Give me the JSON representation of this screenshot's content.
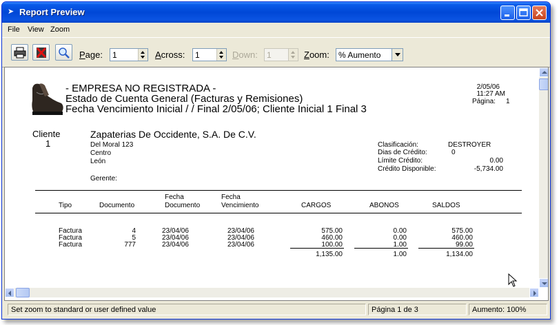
{
  "window": {
    "title": "Report Preview"
  },
  "menu": {
    "items": [
      "File",
      "View",
      "Zoom"
    ]
  },
  "toolbar": {
    "page": {
      "label_u": "P",
      "label_rest": "age:",
      "value": "1"
    },
    "across": {
      "label_u": "A",
      "label_rest": "cross:",
      "value": "1"
    },
    "down": {
      "label_u": "D",
      "label_rest": "own:",
      "value": "1"
    },
    "zoom": {
      "label_u": "Z",
      "label_rest": "oom:",
      "value": "% Aumento"
    }
  },
  "report": {
    "company": "- EMPRESA NO REGISTRADA -",
    "title": "Estado de Cuenta General (Facturas y Remisiones)",
    "subtitle": "Fecha Vencimiento Inicial   /  / Final  2/05/06;   Cliente Inicial 1 Final 3",
    "date": "2/05/06",
    "time": "11:27 AM",
    "page_label": "Página:",
    "page_num": "1",
    "client_label": "Cliente",
    "client_num": "1",
    "client_name": "Zapaterias De Occidente, S.A. De C.V.",
    "address1": "Del Moral 123",
    "address2": "Centro",
    "city": "León",
    "manager_label": "Gerente:",
    "info": {
      "clasificacion_label": "Clasificación:",
      "clasificacion": "DESTROYER",
      "dias_label": "Dias de Crédito:",
      "dias": "0",
      "limite_label": "Límite Crédito:",
      "limite": "0.00",
      "disponible_label": "Crédito Disponible:",
      "disponible": "-5,734.00"
    },
    "columns": {
      "tipo": "Tipo",
      "documento": "Documento",
      "fecha_doc_1": "Fecha",
      "fecha_doc_2": "Documento",
      "fecha_venc_1": "Fecha",
      "fecha_venc_2": "Vencimiento",
      "cargos": "CARGOS",
      "abonos": "ABONOS",
      "saldos": "SALDOS"
    },
    "rows": [
      {
        "tipo": "Factura",
        "documento": "4",
        "fecha_doc": "23/04/06",
        "fecha_venc": "23/04/06",
        "cargos": "575.00",
        "abonos": "0.00",
        "saldos": "575.00"
      },
      {
        "tipo": "Factura",
        "documento": "5",
        "fecha_doc": "23/04/06",
        "fecha_venc": "23/04/06",
        "cargos": "460.00",
        "abonos": "0.00",
        "saldos": "460.00"
      },
      {
        "tipo": "Factura",
        "documento": "777",
        "fecha_doc": "23/04/06",
        "fecha_venc": "23/04/06",
        "cargos": "100.00",
        "abonos": "1.00",
        "saldos": "99.00"
      }
    ],
    "totals": {
      "cargos": "1,135.00",
      "abonos": "1.00",
      "saldos": "1,134.00"
    }
  },
  "status": {
    "hint": "Set zoom to standard or user defined value",
    "page": "Página 1 de 3",
    "zoom": "Aumento: 100%"
  }
}
